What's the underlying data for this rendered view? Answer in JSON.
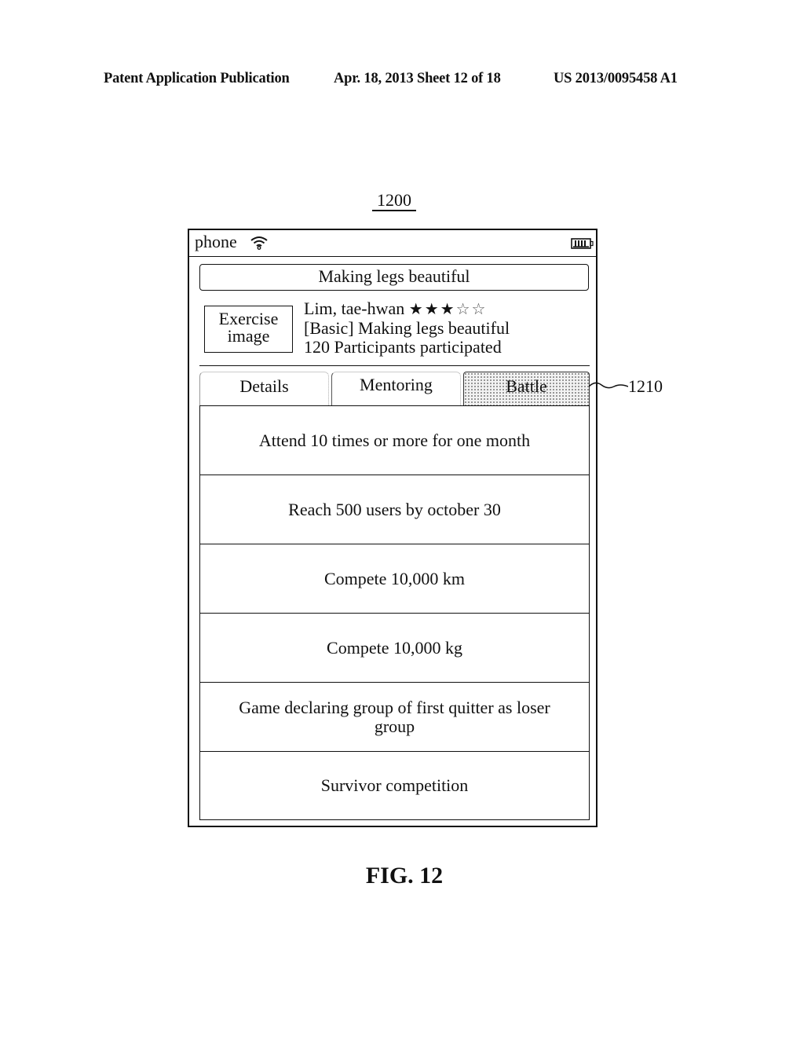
{
  "page_header": {
    "left": "Patent Application Publication",
    "middle": "Apr. 18, 2013  Sheet 12 of 18",
    "right": "US 2013/0095458 A1"
  },
  "figure_ref": "1200",
  "status_bar": {
    "carrier": "phone",
    "wifi_icon": "wifi-icon",
    "battery_icon": "battery-icon"
  },
  "program": {
    "title": "Making legs beautiful",
    "image_placeholder": "Exercise image",
    "instructor": "Lim, tae-hwan",
    "rating": {
      "value": 3,
      "max": 5,
      "filled_star": "★",
      "empty_star": "☆"
    },
    "course": "[Basic] Making legs beautiful",
    "participants": "120 Participants participated"
  },
  "tabs": [
    {
      "label": "Details",
      "selected": false
    },
    {
      "label": "Mentoring",
      "selected": false
    },
    {
      "label": "Battle",
      "selected": true
    }
  ],
  "tab_callout_ref": "1210",
  "battle_items": [
    "Attend 10 times or more for one month",
    "Reach 500 users by october 30",
    "Compete 10,000 km",
    "Compete 10,000 kg",
    "Game declaring group of first quitter as loser group",
    "Survivor competition"
  ],
  "figure_label": "FIG. 12"
}
